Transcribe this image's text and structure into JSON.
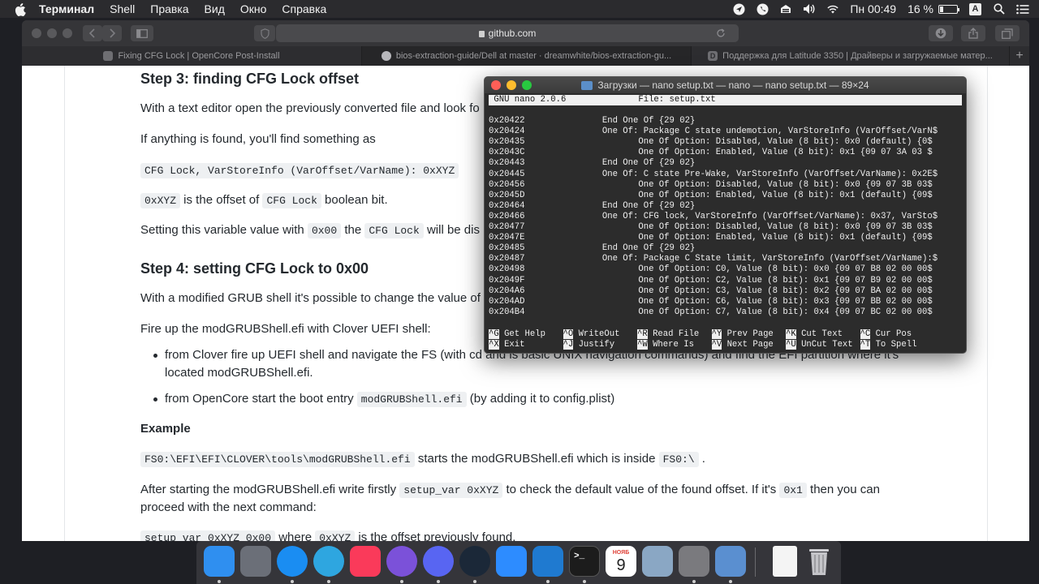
{
  "menubar": {
    "app_name": "Терминал",
    "items": [
      "Shell",
      "Правка",
      "Вид",
      "Окно",
      "Справка"
    ],
    "clock": "Пн 00:49",
    "battery_text": "16 %",
    "battery_level": 0.16,
    "user_initial": "A"
  },
  "safari": {
    "address": "github.com",
    "tabs": [
      {
        "title": "Fixing CFG Lock | OpenCore Post-Install"
      },
      {
        "title": "bios-extraction-guide/Dell at master · dreamwhite/bios-extraction-gu..."
      },
      {
        "title": "Поддержка для Latitude 3350 | Драйверы и загружаемые матер..."
      }
    ],
    "tab_add": "+"
  },
  "article": {
    "step3_heading": "Step 3: finding CFG Lock offset",
    "p1": "With a text editor open the previously converted file and look fo",
    "p2": "If anything is found, you'll find something as",
    "p3_code": "CFG Lock, VarStoreInfo (VarOffset/VarName): 0xXYZ",
    "p4_code1": "0xXYZ",
    "p4_text1": " is the offset of ",
    "p4_code2": "CFG Lock",
    "p4_text2": " boolean bit.",
    "p5_text1": "Setting this variable value with ",
    "p5_code1": "0x00",
    "p5_text2": " the ",
    "p5_code2": "CFG Lock",
    "p5_text3": " will be dis",
    "step4_heading": "Step 4: setting CFG Lock to 0x00",
    "p6": "With a modified GRUB shell it's possible to change the value of",
    "p7": "Fire up the modGRUBShell.efi with Clover UEFI shell:",
    "li1": "from Clover fire up UEFI shell and navigate the FS (with cd and ls basic UNIX navigation commands) and find the EFI partition where it's located modGRUBShell.efi.",
    "li2_text1": "from OpenCore start the boot entry ",
    "li2_code": "modGRUBShell.efi",
    "li2_text2": " (by adding it to config.plist)",
    "example_heading": "Example",
    "ex_code1": "FS0:\\EFI\\EFI\\CLOVER\\tools\\modGRUBShell.efi",
    "ex_text1": " starts the modGRUBShell.efi which is inside ",
    "ex_code2": "FS0:\\",
    "ex_text2": " .",
    "p8_text1": "After starting the modGRUBShell.efi write firstly ",
    "p8_code1": "setup_var 0xXYZ",
    "p8_text2": " to check the default value of the found offset. If it's ",
    "p8_code2": "0x1",
    "p8_text3": " then you can",
    "p8_line2": "proceed with the next command:",
    "p9_code1": "setup_var 0xXYZ 0x00",
    "p9_text1": " where ",
    "p9_code2": "0xXYZ",
    "p9_text2": " is the offset previously found."
  },
  "terminal": {
    "title": "Загрузки — nano setup.txt — nano — nano setup.txt — 89×24",
    "header": " GNU nano 2.0.6              File: setup.txt",
    "lines": [
      "0x20422               End One Of {29 02}",
      "0x20424               One Of: Package C state undemotion, VarStoreInfo (VarOffset/VarN$",
      "0x20435                      One Of Option: Disabled, Value (8 bit): 0x0 (default) {0$",
      "0x2043C                      One Of Option: Enabled, Value (8 bit): 0x1 {09 07 3A 03 $",
      "0x20443               End One Of {29 02}",
      "0x20445               One Of: C state Pre-Wake, VarStoreInfo (VarOffset/VarName): 0x2E$",
      "0x20456                      One Of Option: Disabled, Value (8 bit): 0x0 {09 07 3B 03$",
      "0x2045D                      One Of Option: Enabled, Value (8 bit): 0x1 (default) {09$",
      "0x20464               End One Of {29 02}",
      "0x20466               One Of: CFG lock, VarStoreInfo (VarOffset/VarName): 0x37, VarSto$",
      "0x20477                      One Of Option: Disabled, Value (8 bit): 0x0 {09 07 3B 03$",
      "0x2047E                      One Of Option: Enabled, Value (8 bit): 0x1 (default) {09$",
      "0x20485               End One Of {29 02}",
      "0x20487               One Of: Package C State limit, VarStoreInfo (VarOffset/VarName):$",
      "0x20498                      One Of Option: C0, Value (8 bit): 0x0 {09 07 B8 02 00 00$",
      "0x2049F                      One Of Option: C2, Value (8 bit): 0x1 {09 07 B9 02 00 00$",
      "0x204A6                      One Of Option: C3, Value (8 bit): 0x2 {09 07 BA 02 00 00$",
      "0x204AD                      One Of Option: C6, Value (8 bit): 0x3 {09 07 BB 02 00 00$",
      "0x204B4                      One Of Option: C7, Value (8 bit): 0x4 {09 07 BC 02 00 00$"
    ],
    "shortcuts": [
      {
        "key": "^G",
        "label": "Get Help"
      },
      {
        "key": "^O",
        "label": "WriteOut"
      },
      {
        "key": "^R",
        "label": "Read File"
      },
      {
        "key": "^Y",
        "label": "Prev Page"
      },
      {
        "key": "^K",
        "label": "Cut Text"
      },
      {
        "key": "^C",
        "label": "Cur Pos"
      },
      {
        "key": "^X",
        "label": "Exit"
      },
      {
        "key": "^J",
        "label": "Justify"
      },
      {
        "key": "^W",
        "label": "Where Is"
      },
      {
        "key": "^V",
        "label": "Next Page"
      },
      {
        "key": "^U",
        "label": "UnCut Text"
      },
      {
        "key": "^T",
        "label": "To Spell"
      }
    ]
  },
  "dock": {
    "apps": [
      {
        "name": "finder-icon",
        "color": "#2f8ff0"
      },
      {
        "name": "launchpad-icon",
        "color": "#6b6f78"
      },
      {
        "name": "safari-icon",
        "color": "#1a8df2"
      },
      {
        "name": "telegram-icon",
        "color": "#2ea6e0"
      },
      {
        "name": "music-icon",
        "color": "#fa3a5a"
      },
      {
        "name": "viber-icon",
        "color": "#7b51d9"
      },
      {
        "name": "discord-icon",
        "color": "#5865f2"
      },
      {
        "name": "steam-icon",
        "color": "#1b2838"
      },
      {
        "name": "zoom-icon",
        "color": "#2d8cff"
      },
      {
        "name": "vscode-icon",
        "color": "#1f7ad0"
      },
      {
        "name": "terminal-icon",
        "color": "#1c1c1c"
      },
      {
        "name": "calendar-icon",
        "color": "#ffffff"
      },
      {
        "name": "preview-icon",
        "color": "#8aa7c4"
      },
      {
        "name": "system-preferences-icon",
        "color": "#7a7a7e"
      },
      {
        "name": "xcode-icon",
        "color": "#5a8fd0"
      }
    ],
    "calendar_month": "НОЯБ",
    "calendar_day": "9",
    "terminal_prompt": ">_"
  }
}
